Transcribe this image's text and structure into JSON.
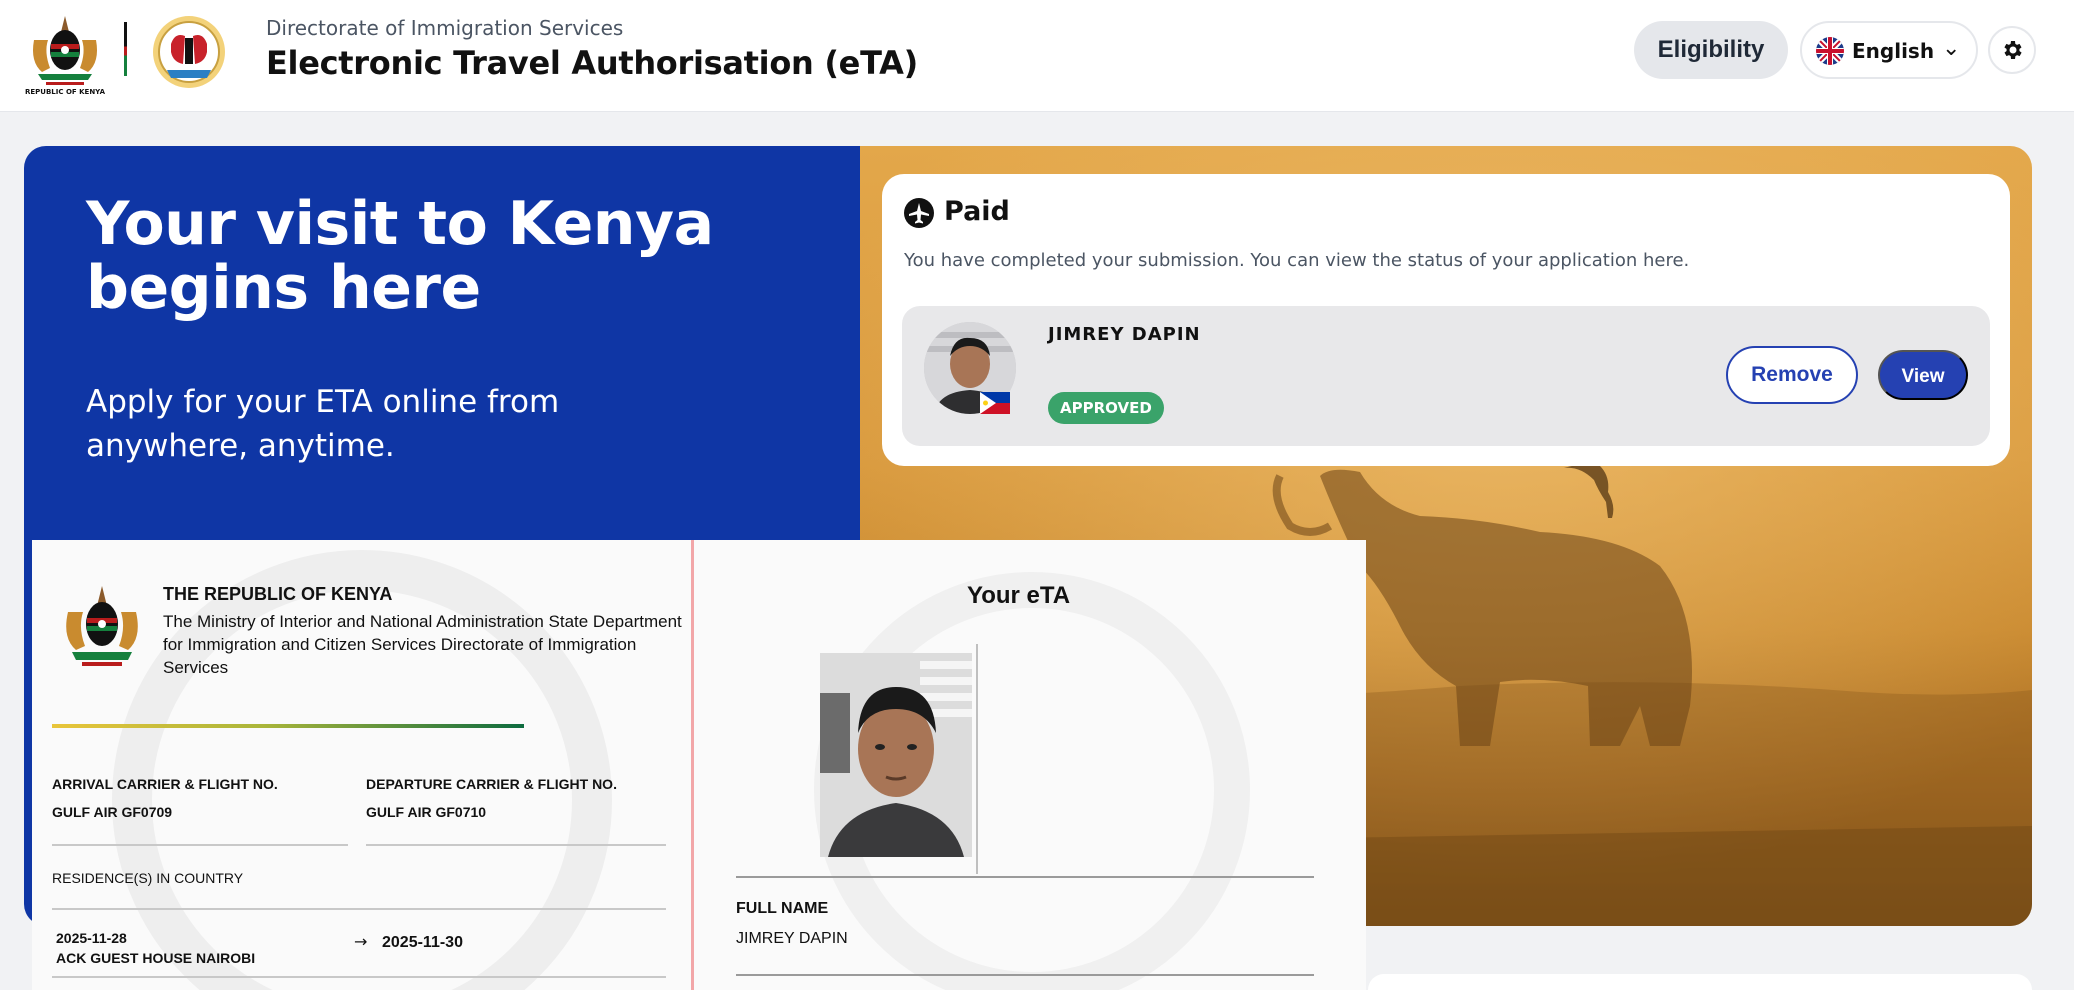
{
  "header": {
    "logo_caption": "REPUBLIC OF KENYA",
    "subtitle": "Directorate of Immigration Services",
    "title": "Electronic Travel Authorisation (eTA)",
    "eligibility_label": "Eligibility",
    "language_label": "English",
    "language_flag_icon": "uk-flag-icon",
    "settings_icon": "gear-icon"
  },
  "hero": {
    "headline": "Your visit to Kenya begins here",
    "subtext": "Apply for your ETA online from anywhere, anytime.",
    "colors": {
      "blue_panel": "#0f36a5",
      "photo_tint": "#d99a3e"
    }
  },
  "status_card": {
    "icon": "airplane-icon",
    "title": "Paid",
    "description": "You have completed your submission. You can view the status of your application here.",
    "applicant": {
      "name": "JIMREY DAPIN",
      "status": "APPROVED",
      "status_color": "#3aa36a",
      "nationality_flag_icon": "philippines-flag-icon"
    },
    "remove_label": "Remove",
    "view_label": "View",
    "accent_color": "#2541b2"
  },
  "eta_document": {
    "coat_of_arms_icon": "kenya-coat-of-arms-icon",
    "republic": "THE REPUBLIC OF KENYA",
    "ministry": "The Ministry of Interior and National Administration State Department for Immigration and Citizen Services Directorate of Immigration Services",
    "arrival_label": "ARRIVAL CARRIER & FLIGHT NO.",
    "arrival_value": "GULF AIR GF0709",
    "departure_label": "DEPARTURE CARRIER & FLIGHT NO.",
    "departure_value": "GULF AIR GF0710",
    "residence_label": "RESIDENCE(S) IN COUNTRY",
    "residence_from": "2025-11-28",
    "residence_place": "ACK GUEST HOUSE NAIROBI",
    "residence_to": "2025-11-30",
    "arrow_glyph": "→",
    "eta_heading": "Your eTA",
    "full_name_label": "FULL NAME",
    "full_name_value": "JIMREY DAPIN"
  }
}
